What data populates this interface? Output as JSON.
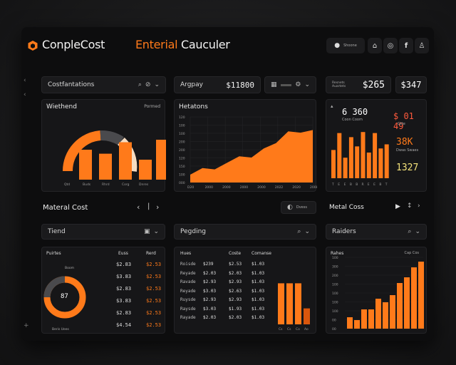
{
  "titlebar": {
    "brand": "ConpleCost",
    "title_accent": "Enterial",
    "title_rest": " Cauculer",
    "action_label": "Shoone"
  },
  "top_row": {
    "filter_label": "Costfantations",
    "metric_label": "Argpay",
    "metric_value": "$11800",
    "stat_one_label": "Resnets Auartets",
    "stat_one_value": "$265",
    "stat_two_value": "$347"
  },
  "panel_a": {
    "title": "Wiethend",
    "tag": "Pormed",
    "x_labels": [
      "Qtd",
      "Buds",
      "Rhrd",
      "Corg",
      "Dnres"
    ]
  },
  "panel_b": {
    "title": "Hetatons",
    "y_labels": [
      "120",
      "100",
      "100",
      "200",
      "200",
      "120",
      "150",
      "100",
      "000"
    ],
    "x_labels": [
      "D20",
      "2000",
      "2000",
      "2000",
      "2000",
      "2022",
      "2020",
      "2008"
    ]
  },
  "panel_c": {
    "headline": "6 360",
    "sub": "Coon Coom",
    "kpi1": "$ 01 49",
    "kpi1_sub": "Gtte",
    "kpi2": "38K",
    "kpi2_sub": "Dwas Swaes",
    "kpi3": "1327",
    "x_labels": [
      "T",
      "E",
      "E",
      "B",
      "B",
      "R",
      "E",
      "E",
      "B",
      "T"
    ]
  },
  "section_left": {
    "title": "Materal Cost",
    "extra": "Dvess"
  },
  "section_right": {
    "title": "Metal Coss"
  },
  "filters": {
    "trend": "Tiend",
    "pricing": "Pegding",
    "builders": "Raiders"
  },
  "panel_d": {
    "title": "Puirtes",
    "col2": "Euss",
    "col3": "Rerd",
    "donut_value": "87",
    "donut_top": "Boom",
    "donut_bottom": "Beris Uees",
    "rows": [
      [
        "$2.83",
        "$2.53"
      ],
      [
        "$3.83",
        "$2.53"
      ],
      [
        "$2.83",
        "$2.53"
      ],
      [
        "$3.83",
        "$2.53"
      ],
      [
        "$2.83",
        "$2.53"
      ],
      [
        "$4.54",
        "$2.53"
      ]
    ]
  },
  "panel_e": {
    "h1": "Hues",
    "h2": "Coste",
    "h3": "Comanse",
    "rows": [
      [
        "Roisde",
        "$239",
        "$2.53",
        "$1.03"
      ],
      [
        "Reyade",
        "$2.03",
        "$2.03",
        "$1.03"
      ],
      [
        "Ravade",
        "$2.93",
        "$2.93",
        "$1.03"
      ],
      [
        "Reyade",
        "$3.03",
        "$2.63",
        "$1.03"
      ],
      [
        "Ruysde",
        "$2.93",
        "$2.93",
        "$1.03"
      ],
      [
        "Raysde",
        "$3.03",
        "$1.93",
        "$1.03"
      ],
      [
        "Rayade",
        "$2.03",
        "$2.03",
        "$1.03"
      ]
    ],
    "x_labels": [
      "Cs",
      "Cs",
      "Co",
      "Ao"
    ],
    "bars": [
      0.9,
      0.9,
      0.9,
      0.35
    ]
  },
  "panel_f": {
    "title": "Rahes",
    "tag": "Cap Cos",
    "y_labels": [
      "100",
      "300",
      "200",
      "100",
      "100",
      "100",
      "100",
      "00",
      "00"
    ],
    "bars": [
      0.16,
      0.12,
      0.27,
      0.27,
      0.42,
      0.37,
      0.47,
      0.64,
      0.72,
      0.86,
      0.94
    ]
  },
  "chart_data": [
    {
      "type": "bar",
      "title": "Wiethend",
      "categories": [
        "Qtd",
        "Buds",
        "Rhrd",
        "Corg",
        "Dnres"
      ],
      "values": [
        60,
        52,
        75,
        40,
        80
      ]
    },
    {
      "type": "area",
      "title": "Hetatons",
      "x": [
        "D20",
        "2000",
        "2000",
        "2000",
        "2000",
        "2022",
        "2020",
        "2008"
      ],
      "values": [
        12,
        22,
        20,
        30,
        40,
        38,
        52,
        60,
        78,
        76,
        80
      ]
    },
    {
      "type": "bar",
      "values": [
        55,
        88,
        40,
        80,
        62,
        90,
        50,
        88,
        58,
        66
      ]
    },
    {
      "type": "pie",
      "values": [
        75,
        25
      ]
    }
  ],
  "colors": {
    "accent": "#ff7a1a",
    "accent_dark": "#d9560c",
    "cream": "#f6dcc2",
    "panel": "#161618",
    "bg": "#0d0d0e",
    "yellow": "#f4e27a",
    "red": "#ff5a3c"
  }
}
